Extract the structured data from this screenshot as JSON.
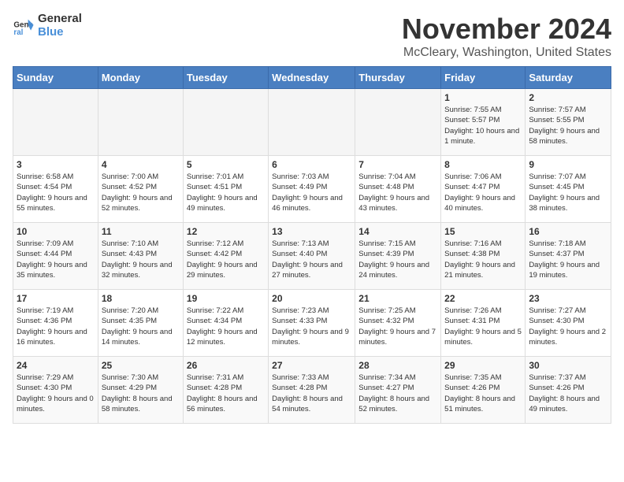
{
  "logo": {
    "line1": "General",
    "line2": "Blue"
  },
  "title": "November 2024",
  "location": "McCleary, Washington, United States",
  "headers": [
    "Sunday",
    "Monday",
    "Tuesday",
    "Wednesday",
    "Thursday",
    "Friday",
    "Saturday"
  ],
  "weeks": [
    [
      {
        "day": "",
        "info": ""
      },
      {
        "day": "",
        "info": ""
      },
      {
        "day": "",
        "info": ""
      },
      {
        "day": "",
        "info": ""
      },
      {
        "day": "",
        "info": ""
      },
      {
        "day": "1",
        "info": "Sunrise: 7:55 AM\nSunset: 5:57 PM\nDaylight: 10 hours and 1 minute."
      },
      {
        "day": "2",
        "info": "Sunrise: 7:57 AM\nSunset: 5:55 PM\nDaylight: 9 hours and 58 minutes."
      }
    ],
    [
      {
        "day": "3",
        "info": "Sunrise: 6:58 AM\nSunset: 4:54 PM\nDaylight: 9 hours and 55 minutes."
      },
      {
        "day": "4",
        "info": "Sunrise: 7:00 AM\nSunset: 4:52 PM\nDaylight: 9 hours and 52 minutes."
      },
      {
        "day": "5",
        "info": "Sunrise: 7:01 AM\nSunset: 4:51 PM\nDaylight: 9 hours and 49 minutes."
      },
      {
        "day": "6",
        "info": "Sunrise: 7:03 AM\nSunset: 4:49 PM\nDaylight: 9 hours and 46 minutes."
      },
      {
        "day": "7",
        "info": "Sunrise: 7:04 AM\nSunset: 4:48 PM\nDaylight: 9 hours and 43 minutes."
      },
      {
        "day": "8",
        "info": "Sunrise: 7:06 AM\nSunset: 4:47 PM\nDaylight: 9 hours and 40 minutes."
      },
      {
        "day": "9",
        "info": "Sunrise: 7:07 AM\nSunset: 4:45 PM\nDaylight: 9 hours and 38 minutes."
      }
    ],
    [
      {
        "day": "10",
        "info": "Sunrise: 7:09 AM\nSunset: 4:44 PM\nDaylight: 9 hours and 35 minutes."
      },
      {
        "day": "11",
        "info": "Sunrise: 7:10 AM\nSunset: 4:43 PM\nDaylight: 9 hours and 32 minutes."
      },
      {
        "day": "12",
        "info": "Sunrise: 7:12 AM\nSunset: 4:42 PM\nDaylight: 9 hours and 29 minutes."
      },
      {
        "day": "13",
        "info": "Sunrise: 7:13 AM\nSunset: 4:40 PM\nDaylight: 9 hours and 27 minutes."
      },
      {
        "day": "14",
        "info": "Sunrise: 7:15 AM\nSunset: 4:39 PM\nDaylight: 9 hours and 24 minutes."
      },
      {
        "day": "15",
        "info": "Sunrise: 7:16 AM\nSunset: 4:38 PM\nDaylight: 9 hours and 21 minutes."
      },
      {
        "day": "16",
        "info": "Sunrise: 7:18 AM\nSunset: 4:37 PM\nDaylight: 9 hours and 19 minutes."
      }
    ],
    [
      {
        "day": "17",
        "info": "Sunrise: 7:19 AM\nSunset: 4:36 PM\nDaylight: 9 hours and 16 minutes."
      },
      {
        "day": "18",
        "info": "Sunrise: 7:20 AM\nSunset: 4:35 PM\nDaylight: 9 hours and 14 minutes."
      },
      {
        "day": "19",
        "info": "Sunrise: 7:22 AM\nSunset: 4:34 PM\nDaylight: 9 hours and 12 minutes."
      },
      {
        "day": "20",
        "info": "Sunrise: 7:23 AM\nSunset: 4:33 PM\nDaylight: 9 hours and 9 minutes."
      },
      {
        "day": "21",
        "info": "Sunrise: 7:25 AM\nSunset: 4:32 PM\nDaylight: 9 hours and 7 minutes."
      },
      {
        "day": "22",
        "info": "Sunrise: 7:26 AM\nSunset: 4:31 PM\nDaylight: 9 hours and 5 minutes."
      },
      {
        "day": "23",
        "info": "Sunrise: 7:27 AM\nSunset: 4:30 PM\nDaylight: 9 hours and 2 minutes."
      }
    ],
    [
      {
        "day": "24",
        "info": "Sunrise: 7:29 AM\nSunset: 4:30 PM\nDaylight: 9 hours and 0 minutes."
      },
      {
        "day": "25",
        "info": "Sunrise: 7:30 AM\nSunset: 4:29 PM\nDaylight: 8 hours and 58 minutes."
      },
      {
        "day": "26",
        "info": "Sunrise: 7:31 AM\nSunset: 4:28 PM\nDaylight: 8 hours and 56 minutes."
      },
      {
        "day": "27",
        "info": "Sunrise: 7:33 AM\nSunset: 4:28 PM\nDaylight: 8 hours and 54 minutes."
      },
      {
        "day": "28",
        "info": "Sunrise: 7:34 AM\nSunset: 4:27 PM\nDaylight: 8 hours and 52 minutes."
      },
      {
        "day": "29",
        "info": "Sunrise: 7:35 AM\nSunset: 4:26 PM\nDaylight: 8 hours and 51 minutes."
      },
      {
        "day": "30",
        "info": "Sunrise: 7:37 AM\nSunset: 4:26 PM\nDaylight: 8 hours and 49 minutes."
      }
    ]
  ]
}
